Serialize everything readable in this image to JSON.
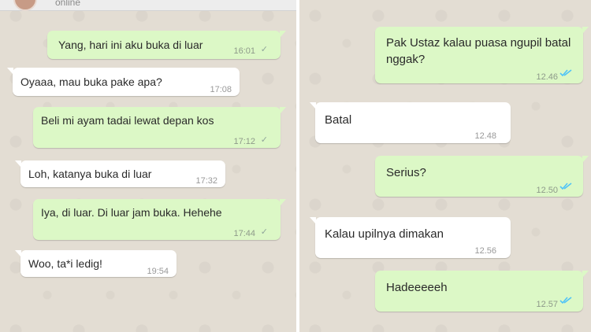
{
  "left_chat": {
    "header": {
      "status": "online"
    },
    "messages": [
      {
        "text": "Yang, hari ini aku buka di luar",
        "time": "16:01",
        "direction": "out",
        "status": "sent"
      },
      {
        "text": "Oyaaa, mau buka pake apa?",
        "time": "17:08",
        "direction": "in"
      },
      {
        "text": "Beli mi ayam tadai lewat depan kos",
        "time": "17:12",
        "direction": "out",
        "status": "sent"
      },
      {
        "text": "Loh, katanya buka di luar",
        "time": "17:32",
        "direction": "in"
      },
      {
        "text": "Iya, di luar. Di luar jam buka. Hehehe",
        "time": "17:44",
        "direction": "out",
        "status": "sent"
      },
      {
        "text": "Woo, ta*i ledig!",
        "time": "19:54",
        "direction": "in"
      }
    ]
  },
  "right_chat": {
    "messages": [
      {
        "text": "Pak Ustaz kalau puasa ngupil batal nggak?",
        "time": "12.46",
        "direction": "out",
        "status": "read"
      },
      {
        "text": "Batal",
        "time": "12.48",
        "direction": "in"
      },
      {
        "text": "Serius?",
        "time": "12.50",
        "direction": "out",
        "status": "read"
      },
      {
        "text": "Kalau upilnya dimakan",
        "time": "12.56",
        "direction": "in"
      },
      {
        "text": "Hadeeeeeh",
        "time": "12.57",
        "direction": "out",
        "status": "read"
      }
    ]
  },
  "colors": {
    "wallpaper": "#e3ddd3",
    "outgoing_bubble": "#dcf8c6",
    "incoming_bubble": "#ffffff",
    "read_tick": "#4fc3f7",
    "sent_tick": "#8fa59a"
  },
  "icons": [
    "avatar",
    "sent-check-icon",
    "read-double-check-icon"
  ]
}
